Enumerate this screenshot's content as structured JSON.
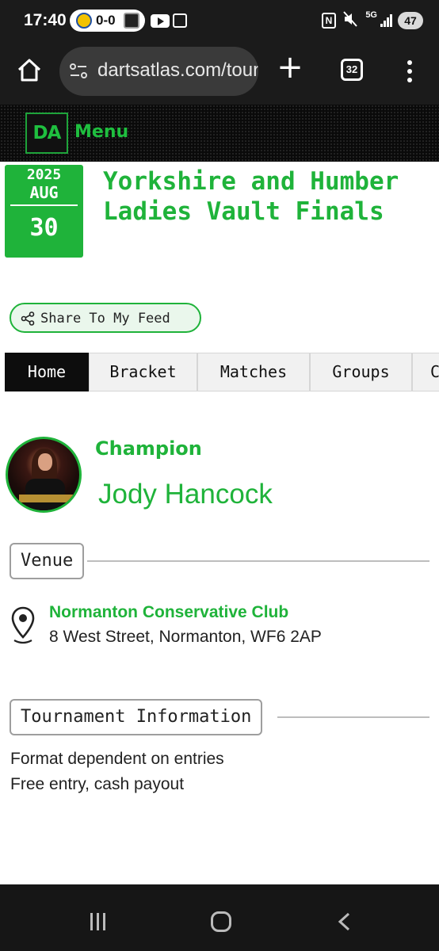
{
  "status_bar": {
    "time": "17:40",
    "score": "0-0",
    "battery": "47",
    "network": "5G"
  },
  "browser": {
    "url": "dartsatlas.com/tournaments",
    "tab_count": "32"
  },
  "site_header": {
    "logo_text": "DA",
    "menu_label": "Menu"
  },
  "event": {
    "year": "2025",
    "month": "AUG",
    "day": "30",
    "title": "Yorkshire and Humber Ladies Vault Finals"
  },
  "share_label": "Share To My Feed",
  "tabs": [
    {
      "label": "Home",
      "active": true
    },
    {
      "label": "Bracket",
      "active": false
    },
    {
      "label": "Matches",
      "active": false
    },
    {
      "label": "Groups",
      "active": false
    },
    {
      "label": "C",
      "active": false
    }
  ],
  "champion": {
    "label": "Champion",
    "name": "Jody Hancock"
  },
  "venue": {
    "heading": "Venue",
    "name": "Normanton Conservative Club",
    "address": "8 West Street, Normanton, WF6 2AP"
  },
  "tournament_info": {
    "heading": "Tournament Information",
    "lines": [
      "Format dependent on entries",
      "Free entry, cash payout"
    ]
  },
  "colors": {
    "brand_green": "#1fb33a",
    "header_bg": "#0a0a0a",
    "tab_active_bg": "#0d0d0d"
  }
}
